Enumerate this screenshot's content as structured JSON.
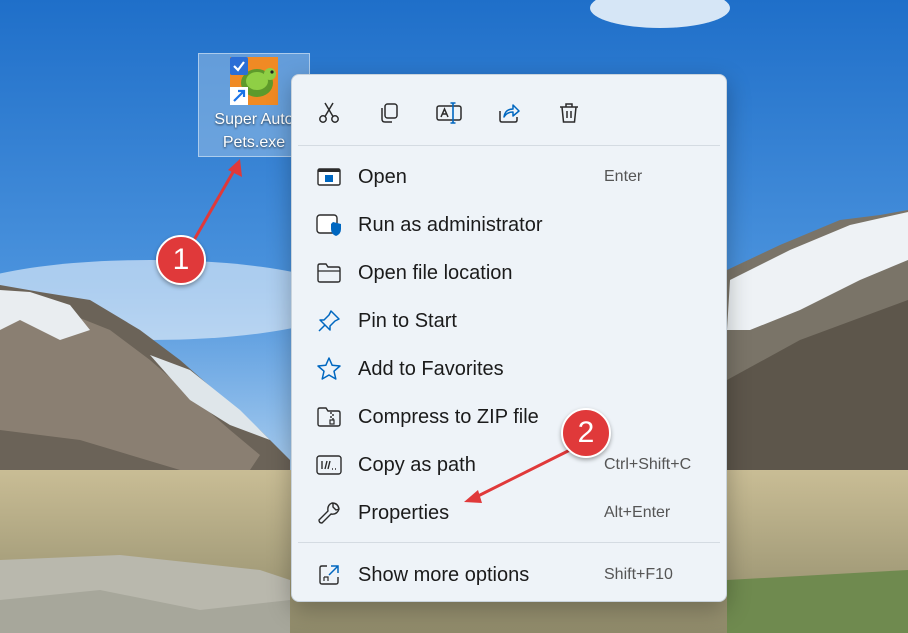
{
  "desktop": {
    "icon_label": "Super Auto\nPets.exe"
  },
  "context_menu": {
    "toolbar": [
      {
        "name": "cut-icon"
      },
      {
        "name": "copy-icon"
      },
      {
        "name": "rename-icon"
      },
      {
        "name": "share-icon"
      },
      {
        "name": "delete-icon"
      }
    ],
    "items": [
      {
        "label": "Open",
        "shortcut": "Enter",
        "icon": "open-icon"
      },
      {
        "label": "Run as administrator",
        "shortcut": "",
        "icon": "shield-icon"
      },
      {
        "label": "Open file location",
        "shortcut": "",
        "icon": "folder-icon"
      },
      {
        "label": "Pin to Start",
        "shortcut": "",
        "icon": "pin-icon"
      },
      {
        "label": "Add to Favorites",
        "shortcut": "",
        "icon": "star-icon"
      },
      {
        "label": "Compress to ZIP file",
        "shortcut": "",
        "icon": "zip-icon"
      },
      {
        "label": "Copy as path",
        "shortcut": "Ctrl+Shift+C",
        "icon": "path-icon"
      },
      {
        "label": "Properties",
        "shortcut": "Alt+Enter",
        "icon": "wrench-icon"
      },
      {
        "label": "Show more options",
        "shortcut": "Shift+F10",
        "icon": "more-options-icon"
      }
    ]
  },
  "annotations": {
    "badge1": "1",
    "badge2": "2"
  },
  "colors": {
    "accent": "#0067c0",
    "badge": "#e0393a"
  }
}
